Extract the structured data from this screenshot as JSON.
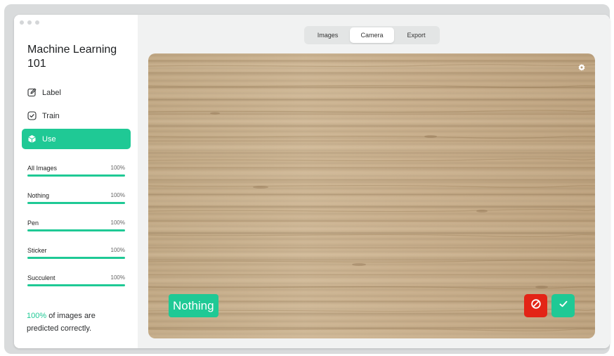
{
  "app": {
    "title": "Machine Learning 101"
  },
  "nav": [
    {
      "label": "Label",
      "icon": "edit-icon"
    },
    {
      "label": "Train",
      "icon": "check-circle-icon"
    },
    {
      "label": "Use",
      "icon": "cube-icon",
      "active": true
    }
  ],
  "progress": [
    {
      "label": "All Images",
      "value": "100%",
      "fraction": 1.0
    },
    {
      "label": "Nothing",
      "value": "100%",
      "fraction": 1.0
    },
    {
      "label": "Pen",
      "value": "100%",
      "fraction": 1.0
    },
    {
      "label": "Sticker",
      "value": "100%",
      "fraction": 1.0
    },
    {
      "label": "Succulent",
      "value": "100%",
      "fraction": 1.0
    }
  ],
  "summary": {
    "percent": "100%",
    "text": " of images are predicted correctly."
  },
  "tabs": [
    {
      "label": "Images"
    },
    {
      "label": "Camera",
      "active": true
    },
    {
      "label": "Export"
    }
  ],
  "camera": {
    "prediction": "Nothing",
    "settings_icon": "gear-icon",
    "wrong_icon": "block-icon",
    "right_icon": "check-icon"
  },
  "colors": {
    "accent": "#1fc995",
    "danger": "#e32416",
    "background": "#f1f2f2"
  }
}
